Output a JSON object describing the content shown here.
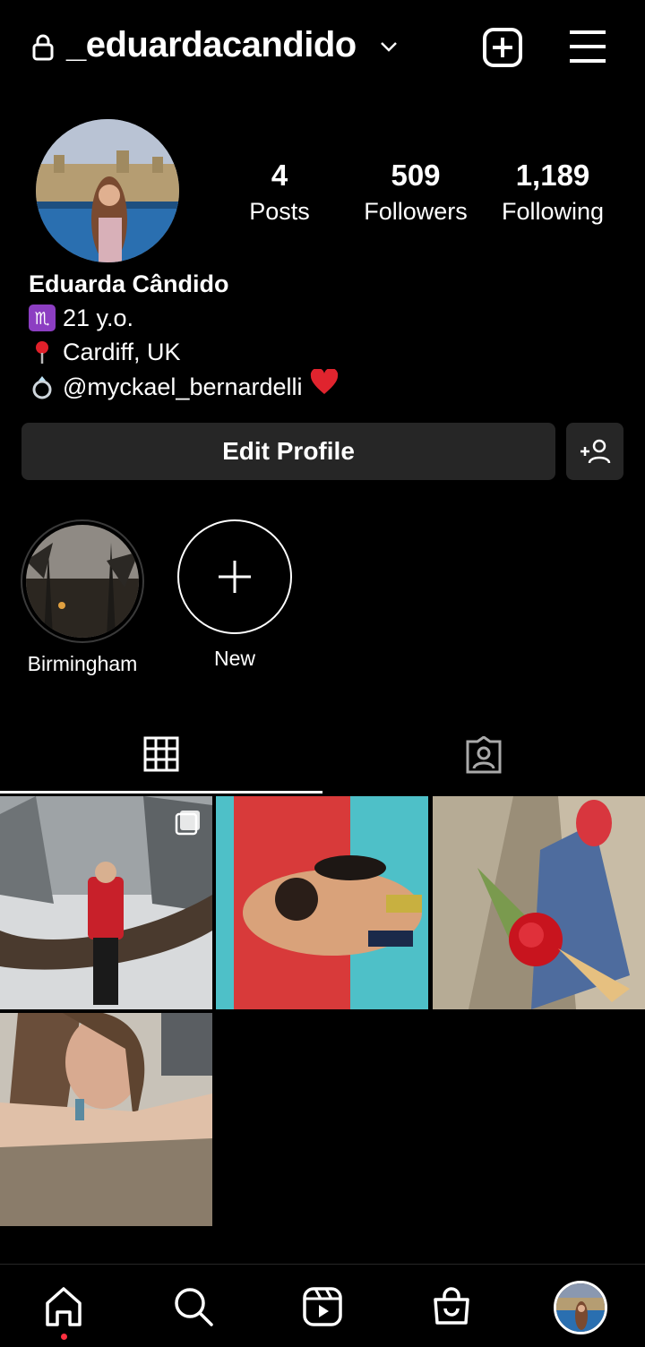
{
  "header": {
    "username": "_eduardacandido",
    "icons": [
      "lock-icon",
      "chevron-down-icon",
      "new-post-icon",
      "menu-icon"
    ]
  },
  "profile": {
    "stats": [
      {
        "value": "4",
        "label": "Posts"
      },
      {
        "value": "509",
        "label": "Followers"
      },
      {
        "value": "1,189",
        "label": "Following"
      }
    ],
    "name": "Eduarda Cândido",
    "bio_lines": [
      {
        "icon": "scorpio-icon",
        "text": "21 y.o."
      },
      {
        "icon": "pin-icon",
        "text": "Cardiff, UK"
      },
      {
        "icon": "ring-icon",
        "text": "@myckael_bernardelli"
      }
    ],
    "bio_suffix_icon": "heart-icon",
    "edit_label": "Edit Profile"
  },
  "highlights": [
    {
      "label": "Birmingham"
    },
    {
      "label": "New"
    }
  ],
  "tabs": [
    "grid-icon",
    "tagged-icon"
  ],
  "posts": [
    {
      "alt": "woman in red coat on snowy tree"
    },
    {
      "alt": "couple lying on red board"
    },
    {
      "alt": "red rose bouquet"
    },
    {
      "alt": "selfie leaning on couch"
    }
  ],
  "nav": [
    "home-icon",
    "search-icon",
    "reels-icon",
    "shop-icon",
    "profile-avatar"
  ],
  "colors": {
    "background": "#000000",
    "button": "#262626",
    "notification": "#ff3040"
  }
}
